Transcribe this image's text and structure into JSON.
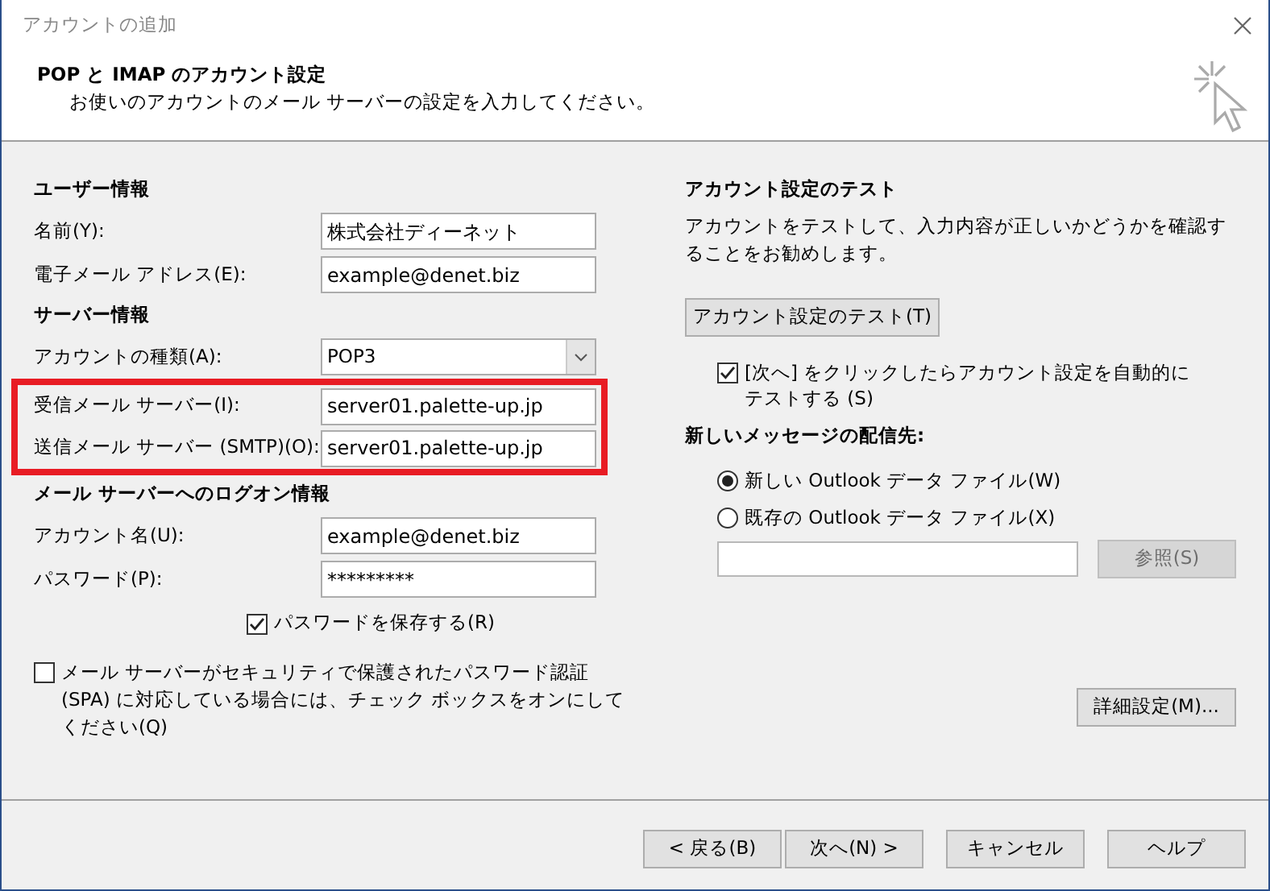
{
  "window": {
    "title": "アカウントの追加"
  },
  "header": {
    "title": "POP と IMAP のアカウント設定",
    "subtitle": "お使いのアカウントのメール サーバーの設定を入力してください。"
  },
  "left": {
    "sections": [
      {
        "heading": "ユーザー情報",
        "fields": [
          {
            "label": "名前(Y):",
            "value": "株式会社ディーネット",
            "kind": "text",
            "highlighted": false
          },
          {
            "label": "電子メール アドレス(E):",
            "value": "example@denet.biz",
            "kind": "text",
            "highlighted": false
          }
        ]
      },
      {
        "heading": "サーバー情報",
        "fields": [
          {
            "label": "アカウントの種類(A):",
            "value": "POP3",
            "kind": "select",
            "highlighted": false
          },
          {
            "label": "受信メール サーバー(I):",
            "value": "server01.palette-up.jp",
            "kind": "text",
            "highlighted": true
          },
          {
            "label": "送信メール サーバー (SMTP)(O):",
            "value": "server01.palette-up.jp",
            "kind": "text",
            "highlighted": true
          }
        ]
      },
      {
        "heading": "メール サーバーへのログオン情報",
        "fields": [
          {
            "label": "アカウント名(U):",
            "value": "example@denet.biz",
            "kind": "text",
            "highlighted": false
          },
          {
            "label": "パスワード(P):",
            "value": "*********",
            "kind": "text",
            "highlighted": false
          }
        ]
      }
    ],
    "save_password": {
      "label": "パスワードを保存する(R)",
      "checked": true
    },
    "spa": {
      "label": "メール サーバーがセキュリティで保護されたパスワード認証 (SPA) に対応している場合には、チェック ボックスをオンにしてください(Q)",
      "checked": false
    }
  },
  "right": {
    "heading": "アカウント設定のテスト",
    "description": "アカウントをテストして、入力内容が正しいかどうかを確認することをお勧めします。",
    "test_button": "アカウント設定のテスト(T)",
    "auto_test": {
      "label": "[次へ] をクリックしたらアカウント設定を自動的にテストする (S)",
      "checked": true
    },
    "delivery_heading": "新しいメッセージの配信先:",
    "delivery_options": [
      {
        "label": "新しい Outlook データ ファイル(W)",
        "selected": true
      },
      {
        "label": "既存の Outlook データ ファイル(X)",
        "selected": false
      }
    ],
    "browse_button": {
      "label": "参照(S)",
      "disabled": true
    },
    "advanced_button": "詳細設定(M)..."
  },
  "footer": {
    "buttons": [
      {
        "label": "< 戻る(B)"
      },
      {
        "label": "次へ(N) >"
      },
      {
        "label": "キャンセル"
      },
      {
        "label": "ヘルプ"
      }
    ]
  }
}
